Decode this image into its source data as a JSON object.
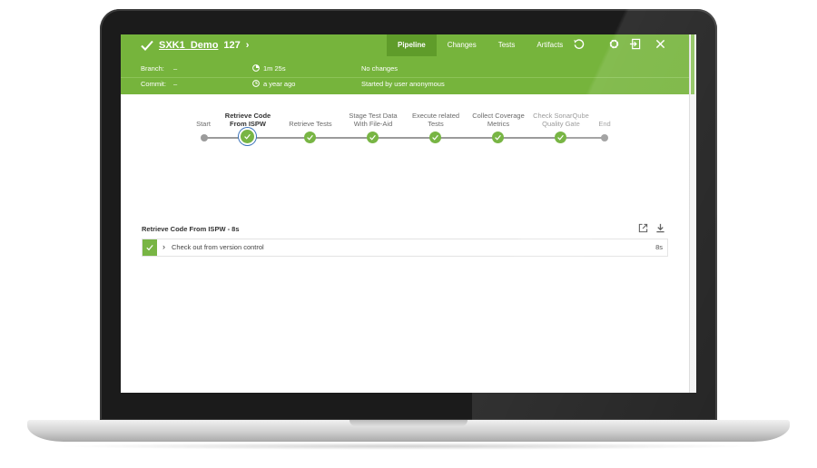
{
  "run": {
    "status_icon": "check-icon",
    "name": "SXK1_Demo",
    "number": "127",
    "chevron": "›"
  },
  "tabs": [
    {
      "label": "Pipeline",
      "active": true
    },
    {
      "label": "Changes",
      "active": false
    },
    {
      "label": "Tests",
      "active": false
    },
    {
      "label": "Artifacts",
      "active": false
    }
  ],
  "header_icons": [
    "replay-icon",
    "gear-icon",
    "exit-icon",
    "close-icon"
  ],
  "info": {
    "branch_label": "Branch:",
    "branch_value": "–",
    "commit_label": "Commit:",
    "commit_value": "–",
    "duration": "1m 25s",
    "time_ago": "a year ago",
    "changes": "No changes",
    "started_by": "Started by user anonymous"
  },
  "pipeline": {
    "stages": [
      {
        "label_lines": [
          "Start"
        ],
        "type": "terminal"
      },
      {
        "label_lines": [
          "Retrieve Code",
          "From ISPW"
        ],
        "type": "success",
        "selected": true
      },
      {
        "label_lines": [
          "Retrieve Tests"
        ],
        "type": "success"
      },
      {
        "label_lines": [
          "Stage Test Data",
          "With File-Aid"
        ],
        "type": "success"
      },
      {
        "label_lines": [
          "Execute related",
          "Tests"
        ],
        "type": "success"
      },
      {
        "label_lines": [
          "Collect Coverage",
          "Metrics"
        ],
        "type": "success"
      },
      {
        "label_lines": [
          "Check SonarQube",
          "Quality Gate"
        ],
        "type": "success"
      },
      {
        "label_lines": [
          "End"
        ],
        "type": "terminal"
      }
    ]
  },
  "step_panel": {
    "title": "Retrieve Code From ISPW - 8s",
    "tools": [
      "open-external-icon",
      "download-icon"
    ],
    "steps": [
      {
        "status": "success",
        "label": "Check out from version control",
        "duration": "8s"
      }
    ]
  },
  "colors": {
    "accent": "#76b43c",
    "accent_dark": "#5f9c2a",
    "selected_ring": "#3b73b9",
    "node_gray": "#9b9b9b"
  }
}
